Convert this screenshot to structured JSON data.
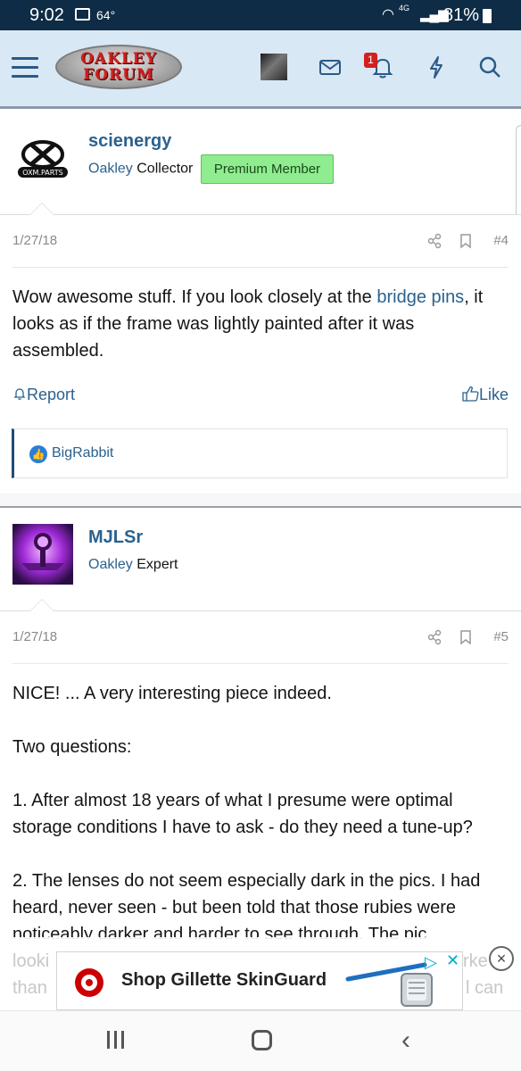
{
  "status_bar": {
    "time": "9:02",
    "temperature": "64°",
    "network": "4G",
    "battery": "81%"
  },
  "header": {
    "logo_text": "OAKLEY FORUM",
    "notification_count": "1",
    "icons": [
      "menu-icon",
      "mail-icon",
      "bell-icon",
      "lightning-icon",
      "search-icon"
    ]
  },
  "posts": [
    {
      "username": "scienergy",
      "title_brand": "Oakley",
      "title_rank": "Collector",
      "badge": "Premium Member",
      "avatar_label": "OXM.PARTS",
      "date": "1/27/18",
      "post_number": "#4",
      "message_before_link": "Wow awesome stuff. If you look closely at the ",
      "message_link": "bridge pins",
      "message_after_link": ", it looks as if the frame was lightly painted after it was assembled.",
      "report_label": "Report",
      "like_label": "Like",
      "liked_by": "BigRabbit"
    },
    {
      "username": "MJLSr",
      "title_brand": "Oakley",
      "title_rank": "Expert",
      "date": "1/27/18",
      "post_number": "#5",
      "paragraphs": [
        "NICE! ... A very interesting piece indeed.",
        "Two questions:",
        "1. After almost 18 years of what I presume were optimal storage conditions I have to ask - do they need a tune-up?",
        "2. The lenses do not seem especially dark in the pics. I had heard, never seen - but been told that those rubies were noticeably darker and harder to see through. The pic"
      ],
      "faded_lines": [
        "looki",
        "rke",
        "than",
        "l can"
      ]
    }
  ],
  "ad": {
    "text": "Shop Gillette SkinGuard",
    "brand_icon": "target-logo",
    "close_label": "×"
  },
  "colors": {
    "status_bar": "#0e2c45",
    "header_bg": "#d9e8f5",
    "link": "#2a628f",
    "badge_green": "#8fec8f",
    "notification_red": "#d21f1f"
  }
}
